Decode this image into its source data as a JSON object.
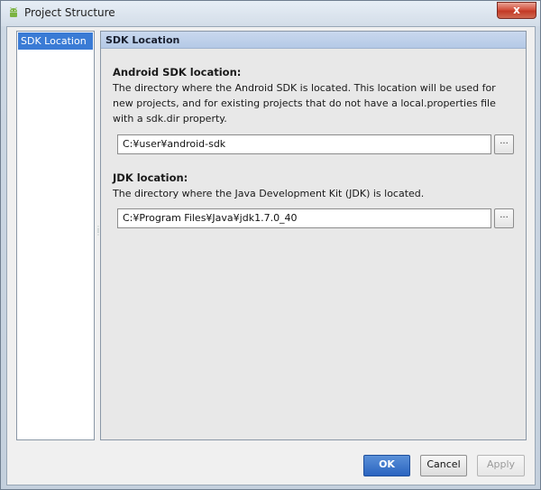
{
  "window": {
    "title": "Project Structure",
    "close_label": "x"
  },
  "sidebar": {
    "items": [
      {
        "label": "SDK Location",
        "selected": true
      }
    ]
  },
  "content": {
    "header": "SDK Location",
    "android_sdk": {
      "label": "Android SDK location:",
      "description": "The directory where the Android SDK is located. This location will be used for new projects, and for existing projects that do not have a local.properties file with a sdk.dir property.",
      "value": "C:¥user¥android-sdk",
      "browse_label": "..."
    },
    "jdk": {
      "label": "JDK location:",
      "description": "The directory where the Java Development Kit (JDK) is located.",
      "value": "C:¥Program Files¥Java¥jdk1.7.0_40",
      "browse_label": "..."
    }
  },
  "buttons": {
    "ok": "OK",
    "cancel": "Cancel",
    "apply": "Apply"
  },
  "colors": {
    "selection": "#3a7bd5",
    "header": "#b4c9e6",
    "ok_button": "#2a64c0"
  },
  "icons": {
    "title_icon": "android-icon"
  }
}
